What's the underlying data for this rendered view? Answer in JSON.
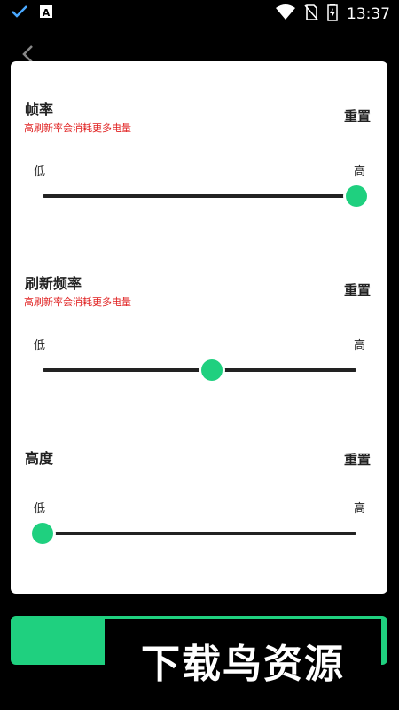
{
  "status_bar": {
    "time": "13:37",
    "icons": [
      "check-icon",
      "a-box-icon",
      "wifi-icon",
      "no-sim-icon",
      "battery-charging-icon"
    ]
  },
  "colors": {
    "accent": "#1fd07f",
    "warning": "#e02020",
    "background": "#000000",
    "card": "#ffffff"
  },
  "sections": [
    {
      "title": "帧率",
      "subtitle": "高刷新率会消耗更多电量",
      "reset_label": "重置",
      "low_label": "低",
      "high_label": "高",
      "slider_value": 1.0
    },
    {
      "title": "刷新频率",
      "subtitle": "高刷新率会消耗更多电量",
      "reset_label": "重置",
      "low_label": "低",
      "high_label": "高",
      "slider_value": 0.54
    },
    {
      "title": "高度",
      "reset_label": "重置",
      "low_label": "低",
      "high_label": "高",
      "slider_value": 0.0
    }
  ],
  "watermark": "下载鸟资源"
}
